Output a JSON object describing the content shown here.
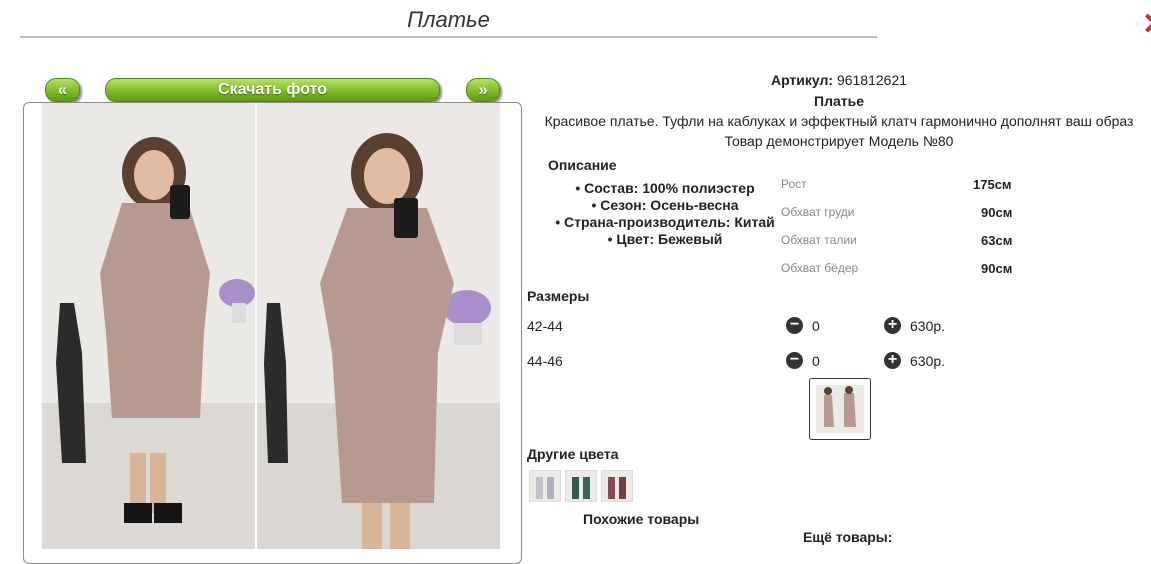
{
  "page": {
    "title": "Платье"
  },
  "nav": {
    "prev_label": "«",
    "download_label": "Скачать фото",
    "next_label": "»"
  },
  "product": {
    "article_label": "Артикул:",
    "article_value": "961812621",
    "name": "Платье",
    "tagline": "Красивое платье. Туфли на каблуках и эффектный клатч гармонично дополнят ваш образ",
    "model_note": "Товар демонстрирует Модель №80"
  },
  "description": {
    "title": "Описание",
    "items": [
      "Состав: 100% полиэстер",
      "Сезон: Осень-весна",
      "Страна-производитель: Китай",
      "Цвет: Бежевый"
    ]
  },
  "measurements": [
    {
      "label": "Рост",
      "value": "175см"
    },
    {
      "label": "Обхват груди",
      "value": "90см"
    },
    {
      "label": "Обхват талии",
      "value": "63см"
    },
    {
      "label": "Обхват бёдер",
      "value": "90см"
    }
  ],
  "sizes": {
    "title": "Размеры",
    "minus_icon": "minus-circle-icon",
    "plus_icon": "plus-circle-icon",
    "rows": [
      {
        "label": "42-44",
        "qty": "0",
        "price": "630р."
      },
      {
        "label": "44-46",
        "qty": "0",
        "price": "630р."
      }
    ]
  },
  "other_colors": {
    "title": "Другие цвета"
  },
  "similar": {
    "title": "Похожие товары"
  },
  "more": {
    "title": "Ещё товары:"
  },
  "colors": {
    "accent_green": "#80bb2a",
    "close_red": "#d32c2c",
    "dress": "#b79a8f"
  }
}
